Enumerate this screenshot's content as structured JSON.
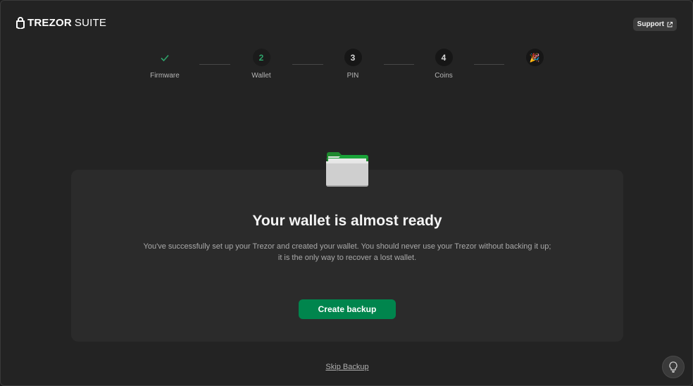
{
  "header": {
    "brand_bold": "TREZOR",
    "brand_light": "SUITE",
    "support_label": "Support"
  },
  "stepper": {
    "steps": [
      {
        "number": "✓",
        "label": "Firmware",
        "state": "done"
      },
      {
        "number": "2",
        "label": "Wallet",
        "state": "active"
      },
      {
        "number": "3",
        "label": "PIN",
        "state": "pending"
      },
      {
        "number": "4",
        "label": "Coins",
        "state": "pending"
      },
      {
        "number": "🎉",
        "label": "",
        "state": "pending"
      }
    ]
  },
  "main": {
    "icon": "folder-icon",
    "title": "Your wallet is almost ready",
    "description": "You've successfully set up your Trezor and created your wallet. You should never use your Trezor without backing it up; it is the only way to recover a lost wallet.",
    "primary_button": "Create backup",
    "skip_link": "Skip Backup"
  },
  "colors": {
    "accent": "#00854d",
    "accent_text": "#2ea36a",
    "background": "#232323",
    "card": "#2b2b2b"
  },
  "icons": {
    "lightbulb": "lightbulb-icon",
    "external": "external-link-icon",
    "lock": "trezor-lock-icon"
  }
}
